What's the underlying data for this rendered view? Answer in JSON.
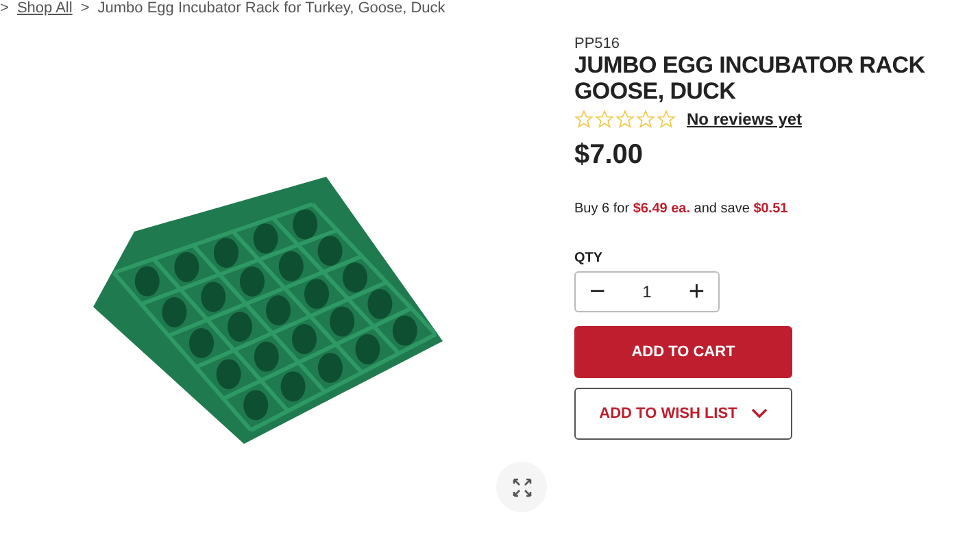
{
  "breadcrumb": {
    "separator_before": ">",
    "link": "Shop All",
    "separator": ">",
    "current": "Jumbo Egg Incubator Rack for Turkey, Goose, Duck"
  },
  "product": {
    "sku": "PP516",
    "title": "JUMBO EGG INCUBATOR RACK GOOSE, DUCK",
    "stars": 0,
    "reviews_link": "No reviews yet",
    "price": "$7.00",
    "bulk_offer": "Buy 6 for **$6.49 ea.** and save **$0.51**",
    "qty_label": "QTY",
    "qty_decrease": "−",
    "qty_value": "1",
    "qty_increase": "+",
    "add_to_cart": "ADD TO CART",
    "add_to_wish_list": "ADD TO WISH LIST"
  }
}
